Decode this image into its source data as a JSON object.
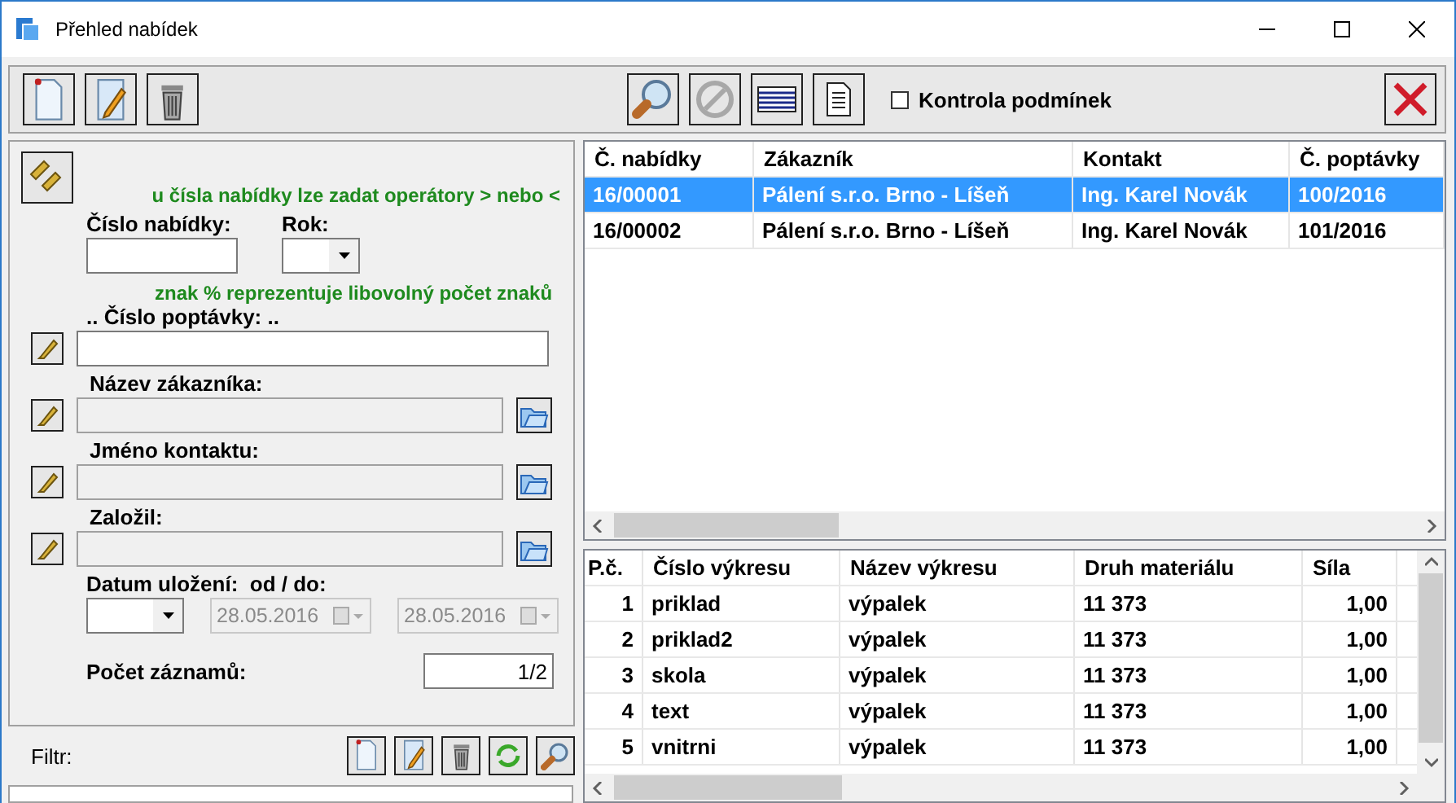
{
  "window": {
    "title": "Přehled nabídek"
  },
  "options": {
    "label": "Kontrola podmínek",
    "checked": false
  },
  "filter_form": {
    "hint_operators": "u čísla nabídky lze zadat operátory > nebo <",
    "offer_number": {
      "label": "Číslo nabídky:"
    },
    "year": {
      "label": "Rok:"
    },
    "hint_wildcard": "znak % reprezentuje libovolný počet znaků",
    "fields": [
      {
        "label": ".. Číslo poptávky: ..",
        "disabled": false,
        "browse": false
      },
      {
        "label": "Název zákazníka:",
        "disabled": true,
        "browse": true
      },
      {
        "label": "Jméno kontaktu:",
        "disabled": true,
        "browse": true
      },
      {
        "label": "Založil:",
        "disabled": true,
        "browse": true
      }
    ],
    "date": {
      "label": "Datum uložení:  od / do:",
      "from": "28.05.2016",
      "to": "28.05.2016",
      "disabled": true
    },
    "count": {
      "label": "Počet záznamů:",
      "value": "1/2"
    }
  },
  "filter_bar": {
    "label": "Filtr:"
  },
  "offers_table": {
    "columns": [
      "Č. nabídky",
      "Zákazník",
      "Kontakt",
      "Č. poptávky"
    ],
    "rows": [
      {
        "cells": [
          "16/00001",
          "Pálení s.r.o. Brno - Líšeň",
          "Ing. Karel Novák",
          "100/2016"
        ],
        "selected": true
      },
      {
        "cells": [
          "16/00002",
          "Pálení s.r.o. Brno - Líšeň",
          "Ing. Karel Novák",
          "101/2016"
        ],
        "selected": false
      }
    ]
  },
  "drawings_table": {
    "columns": [
      "P.č.",
      "Číslo výkresu",
      "Název výkresu",
      "Druh materiálu",
      "Síla"
    ],
    "rows": [
      {
        "cells": [
          "1",
          "priklad",
          "výpalek",
          "11 373",
          "1,00"
        ]
      },
      {
        "cells": [
          "2",
          "priklad2",
          "výpalek",
          "11 373",
          "1,00"
        ]
      },
      {
        "cells": [
          "3",
          "skola",
          "výpalek",
          "11 373",
          "1,00"
        ]
      },
      {
        "cells": [
          "4",
          "text",
          "výpalek",
          "11 373",
          "1,00"
        ]
      },
      {
        "cells": [
          "5",
          "vnitrni",
          "výpalek",
          "11 373",
          "1,00"
        ]
      }
    ]
  }
}
